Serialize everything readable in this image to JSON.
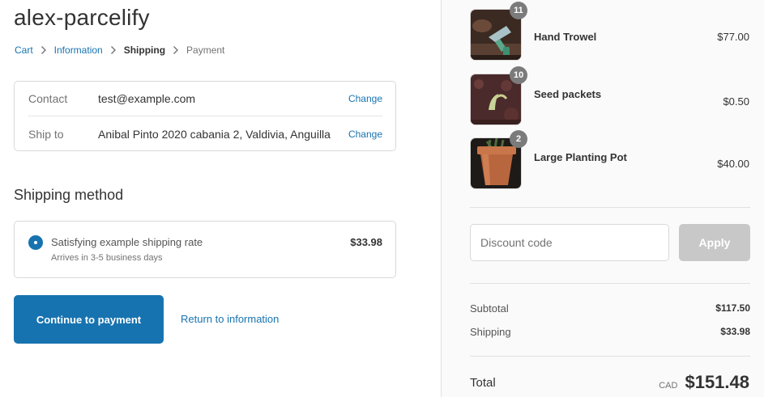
{
  "shop": {
    "name": "alex-parcelify"
  },
  "breadcrumb": [
    {
      "label": "Cart"
    },
    {
      "label": "Information"
    },
    {
      "label": "Shipping"
    },
    {
      "label": "Payment"
    }
  ],
  "review": {
    "contact": {
      "label": "Contact",
      "value": "test@example.com",
      "change": "Change"
    },
    "ship_to": {
      "label": "Ship to",
      "value": "Anibal Pinto 2020 cabania 2, Valdivia, Anguilla",
      "change": "Change"
    }
  },
  "shipping_method": {
    "title": "Shipping method",
    "rate": {
      "name": "Satisfying example shipping rate",
      "subtitle": "Arrives in 3-5 business days",
      "price": "$33.98",
      "selected": true
    }
  },
  "actions": {
    "continue": "Continue to payment",
    "return": "Return to information"
  },
  "cart": {
    "items": [
      {
        "name": "Hand Trowel",
        "quantity": "11",
        "price": "$77.00"
      },
      {
        "name": "Seed packets",
        "quantity": "10",
        "price": "$0.50"
      },
      {
        "name": "Large Planting Pot",
        "quantity": "2",
        "price": "$40.00"
      }
    ]
  },
  "discount": {
    "placeholder": "Discount code",
    "apply": "Apply"
  },
  "summary": {
    "subtotal_label": "Subtotal",
    "subtotal": "$117.50",
    "shipping_label": "Shipping",
    "shipping": "$33.98",
    "total_label": "Total",
    "currency": "CAD",
    "total": "$151.48"
  },
  "colors": {
    "accent": "#1773b0",
    "apply_disabled": "#c8c8c8",
    "sidebar_bg": "#fafafa",
    "badge": "#7b7b7b"
  }
}
